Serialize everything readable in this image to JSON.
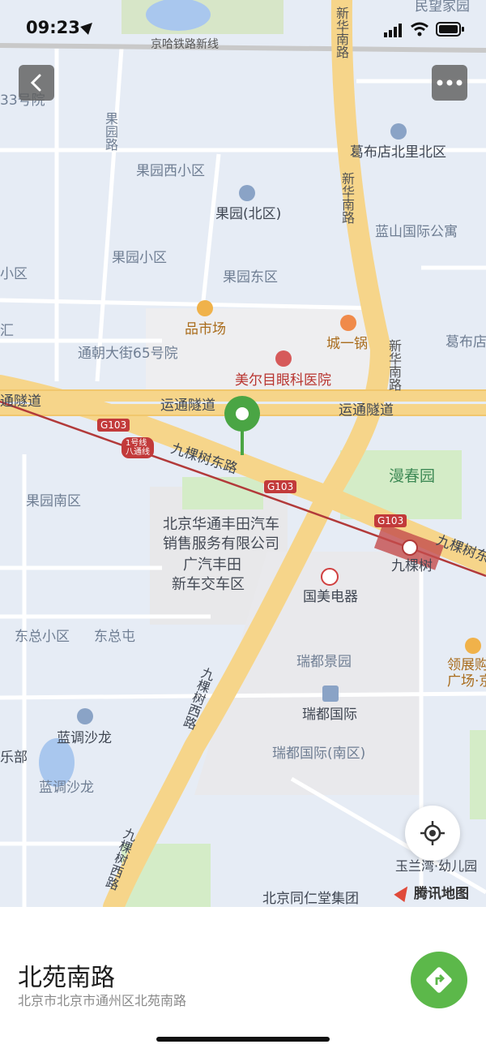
{
  "status": {
    "time": "09:23"
  },
  "map": {
    "labels": {
      "minwang": "民望家园",
      "railway": "京哈铁路新线",
      "no33": "33号院",
      "guoyuan_road": "果园路",
      "guoyuan_west": "果园西小区",
      "guoyuan_north": "果园(北区)",
      "guoyuan_xq": "果园小区",
      "guoyuan_east": "果园东区",
      "gebudian": "葛布店北里北区",
      "lanshan": "蓝山国际公寓",
      "xinhua_north1": "新华南路",
      "xinhua_north2": "新华南路",
      "xinhua_mid": "新华南路",
      "left_xq": "小区",
      "left_hui": "汇",
      "pinshichang": "品市场",
      "chengyiguo": "城一锅",
      "gebudian2": "葛布店",
      "tongchao65": "通朝大街65号院",
      "meier": "美尔目眼科医院",
      "yuntong1": "运通隧道",
      "yuntong2": "运通隧道",
      "yuntong_left": "通隧道",
      "g103_a": "G103",
      "g103_b": "G103",
      "g103_c": "G103",
      "line1": "1号线\n八通线",
      "jiukeshu_east": "九棵树东路",
      "jiukeshu_east2": "九棵树东",
      "manchunyuan": "漫春园",
      "guoyuan_south": "果园南区",
      "huatong1": "北京华通丰田汽车",
      "huatong2": "销售服务有限公司",
      "guangqi1": "广汽丰田",
      "guangqi2": "新车交车区",
      "jiukeshu": "九棵树",
      "gome": "国美电器",
      "dongzong_xq": "东总小区",
      "dongzong_tun": "东总屯",
      "ruidu_jy": "瑞都景园",
      "lingzhan1": "领展购",
      "lingzhan2": "广场·京",
      "ruidu_gj": "瑞都国际",
      "jiukeshu_west": "九棵树西路",
      "jiukeshu_west2": "九棵树西路",
      "landiao1": "蓝调沙龙",
      "landiao2": "蓝调沙龙",
      "lebu": "乐部",
      "ruidu_south": "瑞都国际(南区)",
      "yulanwan": "玉兰湾·幼儿园",
      "tongrentang": "北京同仁堂集团"
    },
    "brand": "腾讯地图"
  },
  "place": {
    "name": "北苑南路",
    "address": "北京市北京市通州区北苑南路"
  },
  "icons": {
    "back": "chevron-left-icon",
    "more": "more-icon",
    "locate": "locate-icon",
    "route": "route-icon",
    "pin": "map-pin-icon"
  },
  "colors": {
    "accent": "#5cb84a",
    "road": "#f6d58a",
    "railway_red": "#b23a3a",
    "park": "#d4ecc7"
  }
}
